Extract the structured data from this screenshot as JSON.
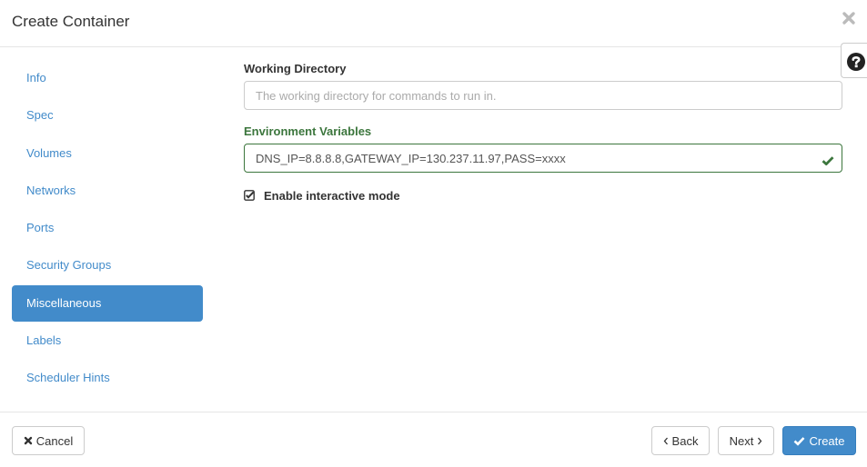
{
  "modal": {
    "title": "Create Container",
    "close_icon": "close-icon",
    "help_icon": "question-circle-icon"
  },
  "sidebar": {
    "items": [
      {
        "label": "Info",
        "active": false
      },
      {
        "label": "Spec",
        "active": false
      },
      {
        "label": "Volumes",
        "active": false
      },
      {
        "label": "Networks",
        "active": false
      },
      {
        "label": "Ports",
        "active": false
      },
      {
        "label": "Security Groups",
        "active": false
      },
      {
        "label": "Miscellaneous",
        "active": true
      },
      {
        "label": "Labels",
        "active": false
      },
      {
        "label": "Scheduler Hints",
        "active": false
      }
    ]
  },
  "form": {
    "working_directory": {
      "label": "Working Directory",
      "value": "",
      "placeholder": "The working directory for commands to run in."
    },
    "environment_variables": {
      "label": "Environment Variables",
      "value": "DNS_IP=8.8.8.8,GATEWAY_IP=130.237.11.97,PASS=xxxx",
      "status": "valid",
      "status_color": "#3c763d"
    },
    "interactive_mode": {
      "label": "Enable interactive mode",
      "checked": true
    }
  },
  "footer": {
    "cancel_label": "Cancel",
    "back_label": "Back",
    "next_label": "Next",
    "create_label": "Create"
  },
  "colors": {
    "primary": "#428bca",
    "success": "#3c763d"
  }
}
